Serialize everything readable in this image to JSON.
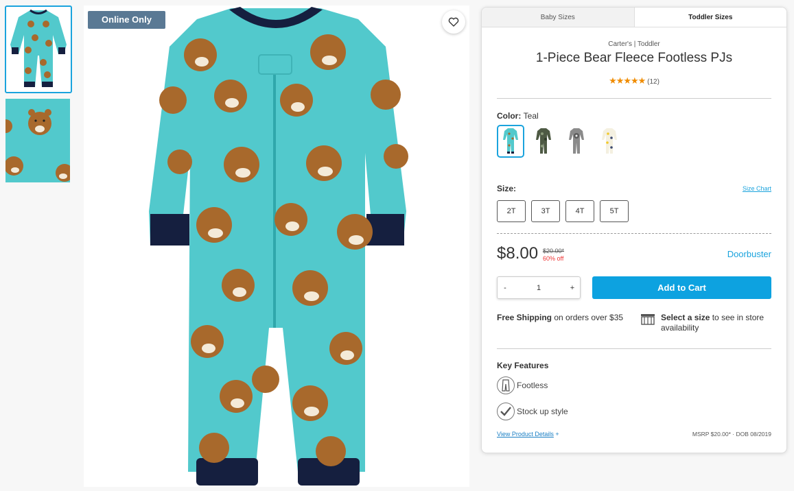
{
  "badge": "Online Only",
  "tabs": [
    "Baby Sizes",
    "Toddler Sizes"
  ],
  "brand": "Carter's | Toddler",
  "title": "1-Piece Bear Fleece Footless PJs",
  "rating": {
    "stars": "★★★★★",
    "count": "(12)"
  },
  "color": {
    "label": "Color:",
    "value": "Teal"
  },
  "swatches": [
    "teal",
    "camo",
    "gray-raccoon",
    "yellow-pattern"
  ],
  "size": {
    "label": "Size:",
    "chart_link": "Size Chart",
    "options": [
      "2T",
      "3T",
      "4T",
      "5T"
    ]
  },
  "price": {
    "current": "$8.00",
    "original": "$20.00*",
    "discount": "60% off",
    "promo": "Doorbuster"
  },
  "quantity": {
    "minus": "-",
    "value": "1",
    "plus": "+"
  },
  "add_to_cart": "Add to Cart",
  "shipping": {
    "bold": "Free Shipping",
    "rest": " on orders over $35"
  },
  "store": {
    "bold": "Select a size",
    "rest": " to see in store availability"
  },
  "features": {
    "title": "Key Features",
    "items": [
      "Footless",
      "Stock up style"
    ]
  },
  "footer": {
    "details": "View Product Details",
    "plus": "+",
    "msrp": "MSRP $20.00* · DOB 08/2019"
  },
  "colors": {
    "accent": "#0da2e0",
    "badge": "#5a7994",
    "garment": "#52c9cc",
    "cuff": "#151f3f",
    "bear": "#a8692c"
  }
}
